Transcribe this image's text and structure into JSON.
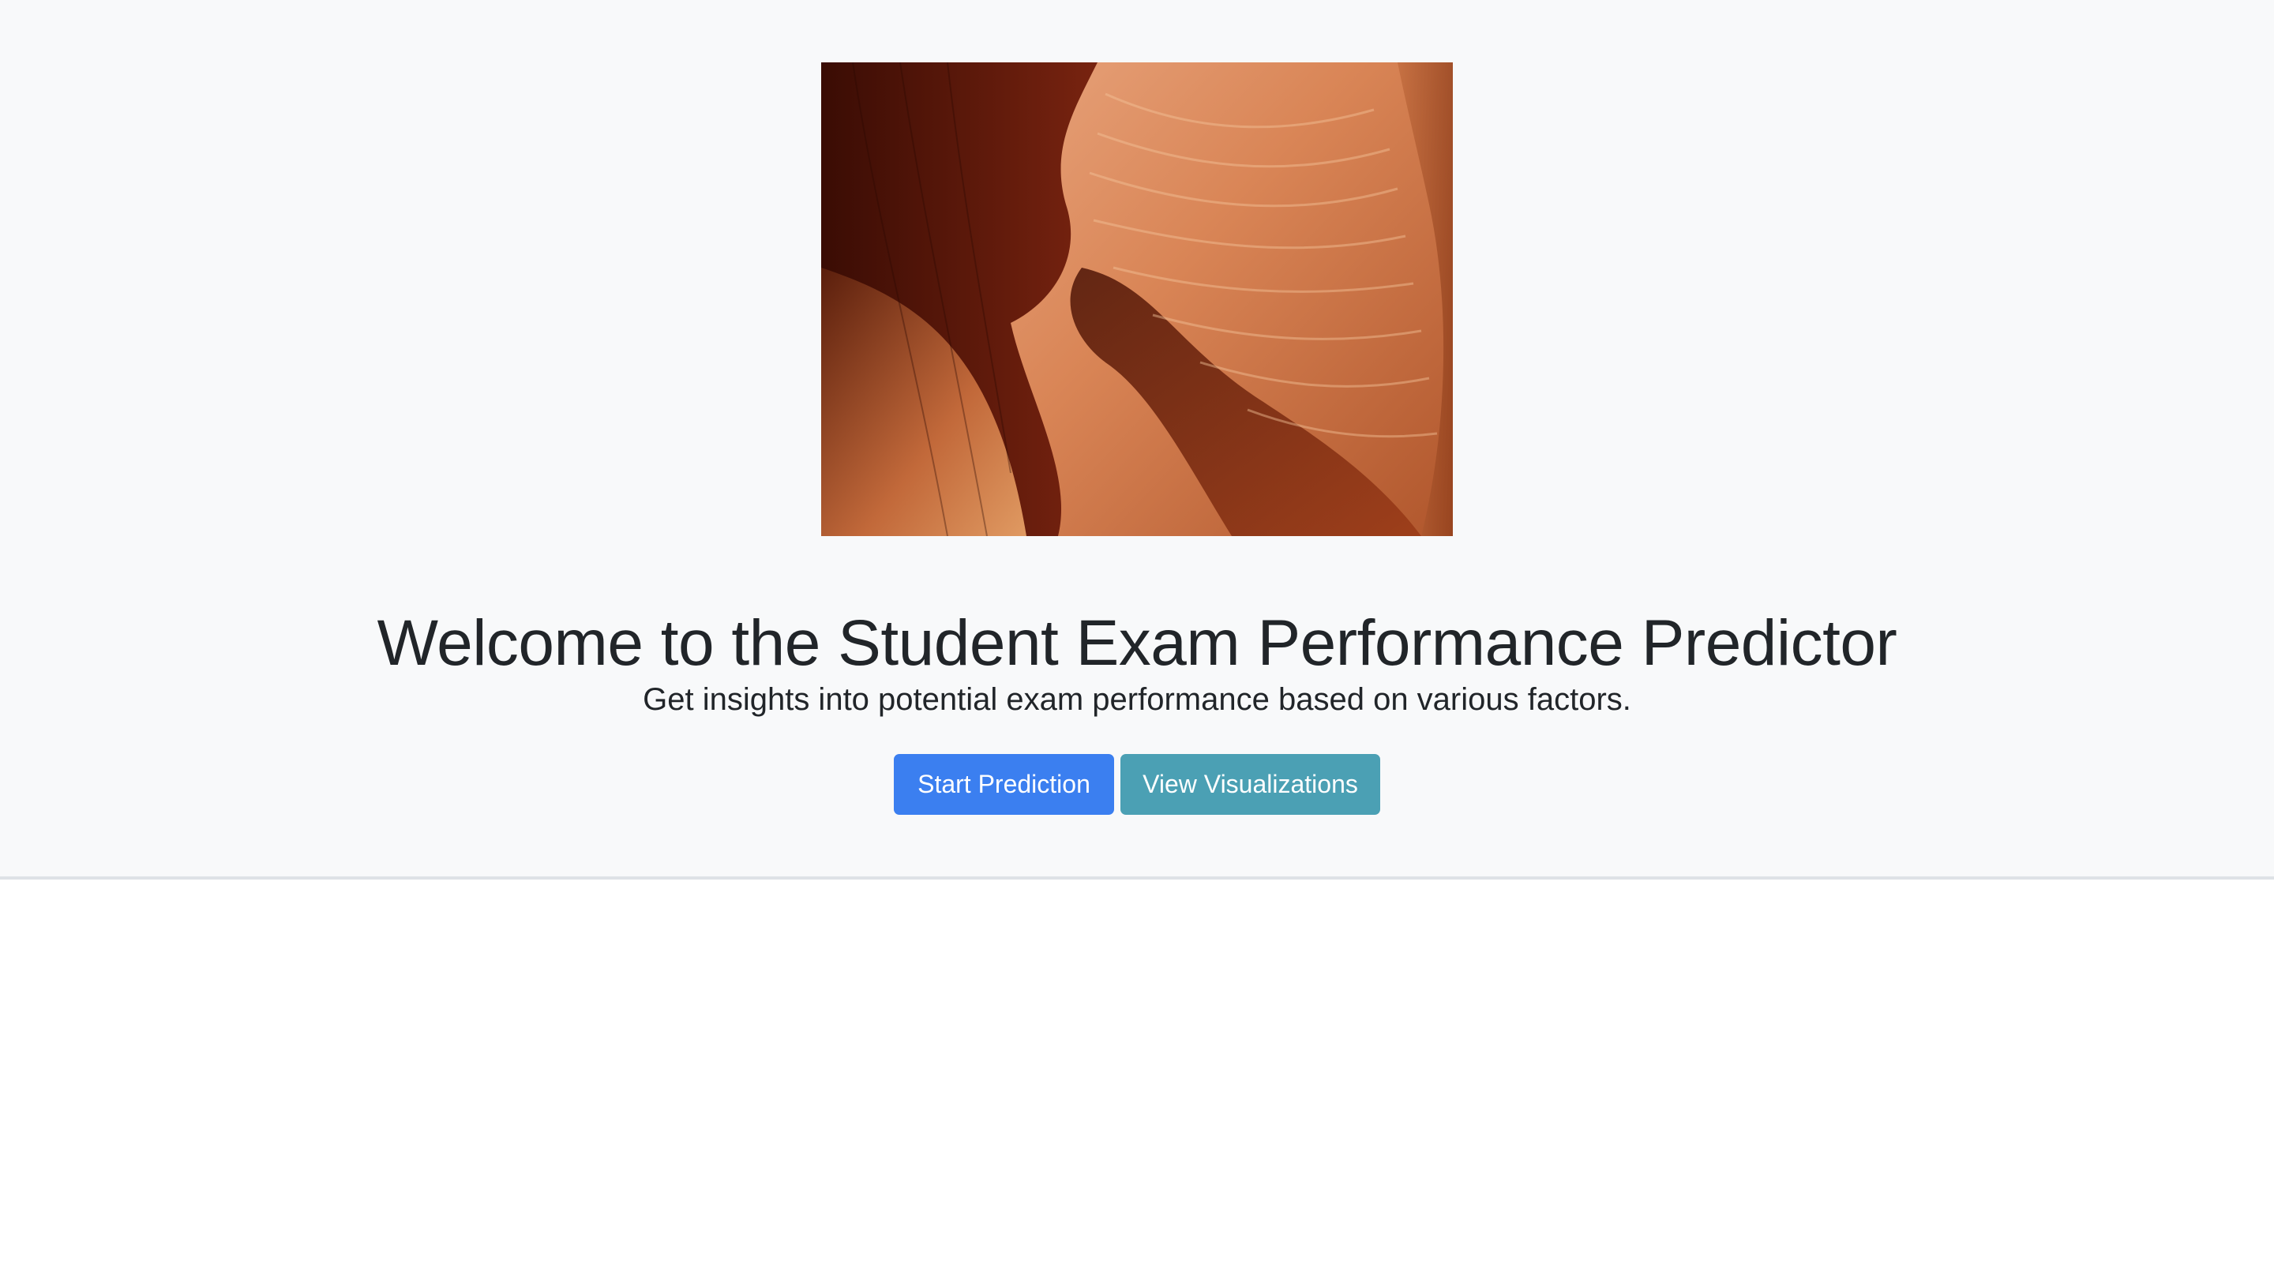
{
  "hero": {
    "image_alt": "Sandstone canyon",
    "title": "Welcome to the Student Exam Performance Predictor",
    "subtitle": "Get insights into potential exam performance based on various factors.",
    "buttons": {
      "start_label": "Start Prediction",
      "visualize_label": "View Visualizations"
    }
  },
  "colors": {
    "hero_background": "#f8f9fa",
    "primary_button": "#3b7ff0",
    "info_button": "#4ba0b4",
    "text": "#212529"
  }
}
